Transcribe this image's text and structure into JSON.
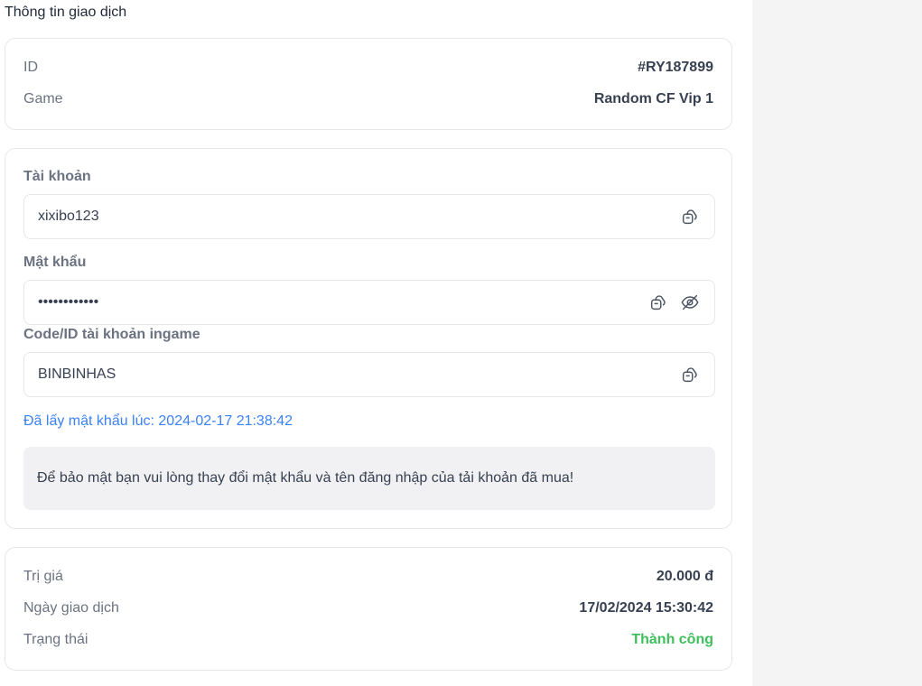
{
  "page": {
    "section_title": "Thông tin giao dịch"
  },
  "info": {
    "id_label": "ID",
    "id_value": "#RY187899",
    "game_label": "Game",
    "game_value": "Random CF Vip 1"
  },
  "account": {
    "username_label": "Tài khoản",
    "username_value": "xixibo123",
    "password_label": "Mật khẩu",
    "password_value": "••••••••••••",
    "ingame_label": "Code/ID tài khoản ingame",
    "ingame_value": "BINBINHAS",
    "password_fetched_note": "Đã lấy mật khẩu lúc: 2024-02-17 21:38:42",
    "security_notice": "Để bảo mật bạn vui lòng thay đổi mật khẩu và tên đăng nhập của tải khoản đã mua!",
    "icons": {
      "copy": "copy-icon",
      "hide": "eye-off-icon"
    }
  },
  "payment": {
    "value_label": "Trị giá",
    "value_amount": "20.000 đ",
    "date_label": "Ngày giao dịch",
    "date_value": "17/02/2024 15:30:42",
    "status_label": "Trạng thái",
    "status_value": "Thành công"
  },
  "colors": {
    "link_blue": "#3b82f6",
    "success_green": "#3fbf5c",
    "notice_bg": "#f1f1f4",
    "side_bg": "#f4f4f5"
  }
}
